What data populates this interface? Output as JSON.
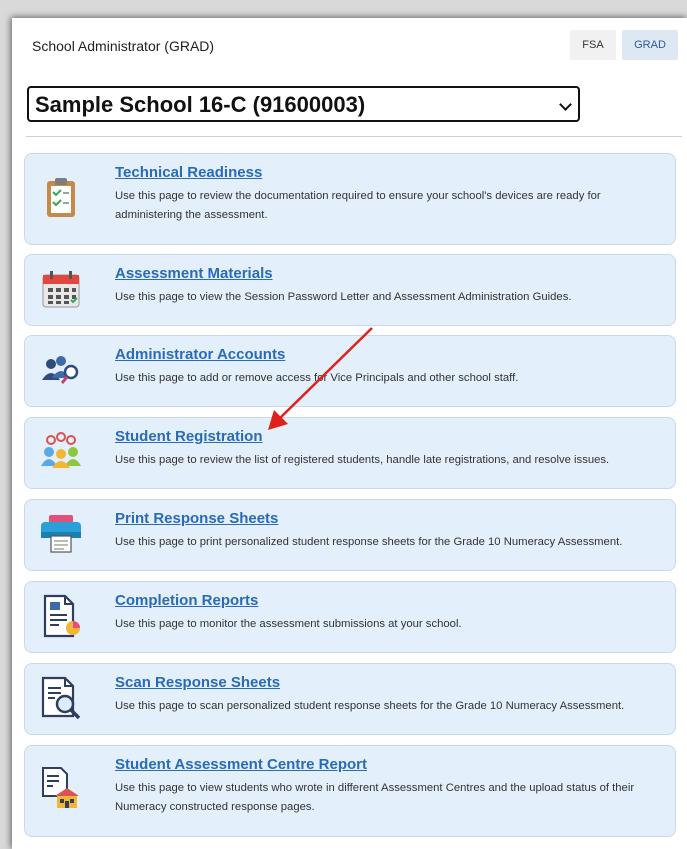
{
  "header": {
    "title": "School Administrator (GRAD)",
    "tabs": [
      {
        "label": "FSA"
      },
      {
        "label": "GRAD"
      }
    ]
  },
  "school_select": {
    "value": "Sample School 16-C (91600003)"
  },
  "cards": [
    {
      "title": "Technical Readiness",
      "description": "Use this page to review the documentation required to ensure your school's devices are ready for administering the assessment.",
      "icon": "clipboard-checklist-icon"
    },
    {
      "title": "Assessment Materials",
      "description": "Use this page to view the Session Password Letter and Assessment Administration Guides.",
      "icon": "calendar-icon"
    },
    {
      "title": "Administrator Accounts",
      "description": "Use this page to add or remove access for Vice Principals and other school staff.",
      "icon": "users-search-icon"
    },
    {
      "title": "Student Registration",
      "description": "Use this page to review the list of registered students, handle late registrations, and resolve issues.",
      "icon": "student-group-icon"
    },
    {
      "title": "Print Response Sheets",
      "description": "Use this page to print personalized student response sheets for the Grade 10 Numeracy Assessment.",
      "icon": "printer-icon"
    },
    {
      "title": "Completion Reports",
      "description": "Use this page to monitor the assessment submissions at your school.",
      "icon": "report-chart-icon"
    },
    {
      "title": "Scan Response Sheets",
      "description": "Use this page to scan personalized student response sheets for the Grade 10 Numeracy Assessment.",
      "icon": "document-magnifier-icon"
    },
    {
      "title": "Student Assessment Centre Report",
      "description": "Use this page to view students who wrote in different Assessment Centres and the upload status of their Numeracy constructed response pages.",
      "icon": "building-report-icon"
    }
  ],
  "annotation": {
    "arrow_color": "#e0201b"
  }
}
